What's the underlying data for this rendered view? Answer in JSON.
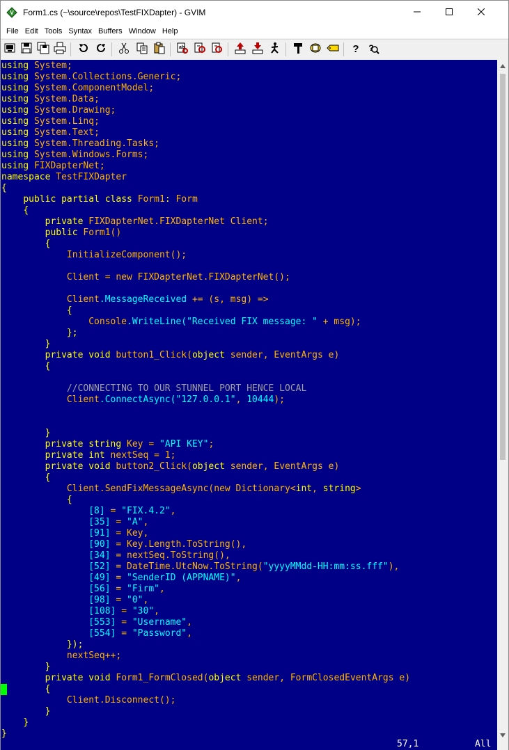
{
  "window": {
    "title": "Form1.cs (~\\source\\repos\\TestFIXDapter) - GVIM"
  },
  "menu": [
    "File",
    "Edit",
    "Tools",
    "Syntax",
    "Buffers",
    "Window",
    "Help"
  ],
  "toolbar": {
    "icons": [
      "open-icon",
      "save-icon",
      "save-all-icon",
      "print-icon",
      "undo-icon",
      "redo-icon",
      "cut-icon",
      "copy-icon",
      "paste-icon",
      "replace-icon",
      "find-next-icon",
      "find-prev-icon",
      "load-session-icon",
      "save-session-icon",
      "run-script-icon",
      "make-icon",
      "shell-icon",
      "tag-jump-icon",
      "help-icon",
      "find-help-icon"
    ]
  },
  "colors": {
    "background": "#000087",
    "keyword": "#ffff00",
    "type": "#ffb400",
    "identifier": "#00ffff",
    "comment": "#a0a0a0",
    "cursor": "#00ff00"
  },
  "code_lines": [
    [
      [
        "k",
        "using"
      ],
      [
        "n",
        " "
      ],
      [
        "t",
        "System"
      ],
      [
        "n",
        ";"
      ]
    ],
    [
      [
        "k",
        "using"
      ],
      [
        "n",
        " "
      ],
      [
        "t",
        "System.Collections.Generic"
      ],
      [
        "n",
        ";"
      ]
    ],
    [
      [
        "k",
        "using"
      ],
      [
        "n",
        " "
      ],
      [
        "t",
        "System.ComponentModel"
      ],
      [
        "n",
        ";"
      ]
    ],
    [
      [
        "k",
        "using"
      ],
      [
        "n",
        " "
      ],
      [
        "t",
        "System.Data"
      ],
      [
        "n",
        ";"
      ]
    ],
    [
      [
        "k",
        "using"
      ],
      [
        "n",
        " "
      ],
      [
        "t",
        "System.Drawing"
      ],
      [
        "n",
        ";"
      ]
    ],
    [
      [
        "k",
        "using"
      ],
      [
        "n",
        " "
      ],
      [
        "t",
        "System.Linq"
      ],
      [
        "n",
        ";"
      ]
    ],
    [
      [
        "k",
        "using"
      ],
      [
        "n",
        " "
      ],
      [
        "t",
        "System.Text"
      ],
      [
        "n",
        ";"
      ]
    ],
    [
      [
        "k",
        "using"
      ],
      [
        "n",
        " "
      ],
      [
        "t",
        "System.Threading.Tasks"
      ],
      [
        "n",
        ";"
      ]
    ],
    [
      [
        "k",
        "using"
      ],
      [
        "n",
        " "
      ],
      [
        "t",
        "System.Windows.Forms"
      ],
      [
        "n",
        ";"
      ]
    ],
    [
      [
        "k",
        "using"
      ],
      [
        "n",
        " "
      ],
      [
        "t",
        "FIXDapterNet"
      ],
      [
        "n",
        ";"
      ]
    ],
    [
      [
        "k",
        "namespace"
      ],
      [
        "t",
        " TestFIXDapter"
      ]
    ],
    [
      [
        "k",
        "{"
      ]
    ],
    [
      [
        "n",
        "    "
      ],
      [
        "k",
        "public partial class"
      ],
      [
        "n",
        " "
      ],
      [
        "t",
        "Form1"
      ],
      [
        "k",
        ":"
      ],
      [
        "t",
        " Form"
      ]
    ],
    [
      [
        "n",
        "    "
      ],
      [
        "k",
        "{"
      ]
    ],
    [
      [
        "n",
        "        "
      ],
      [
        "k",
        "private"
      ],
      [
        "t",
        " FIXDapterNet.FIXDapterNet Client;"
      ]
    ],
    [
      [
        "n",
        "        "
      ],
      [
        "k",
        "public"
      ],
      [
        "t",
        " Form1()"
      ]
    ],
    [
      [
        "n",
        "        "
      ],
      [
        "k",
        "{"
      ]
    ],
    [
      [
        "t",
        "            InitializeComponent();"
      ]
    ],
    [
      [
        "n",
        ""
      ]
    ],
    [
      [
        "t",
        "            Client = new FIXDapterNet.FIXDapterNet();"
      ]
    ],
    [
      [
        "n",
        ""
      ]
    ],
    [
      [
        "t",
        "            Client"
      ],
      [
        "i",
        ".MessageReceived"
      ],
      [
        "t",
        " += (s, msg) =>"
      ]
    ],
    [
      [
        "n",
        "            "
      ],
      [
        "k",
        "{"
      ]
    ],
    [
      [
        "t",
        "                Console"
      ],
      [
        "i",
        ".WriteLine("
      ],
      [
        "i",
        "\"Received FIX message: \""
      ],
      [
        "t",
        " + msg);"
      ]
    ],
    [
      [
        "n",
        "            "
      ],
      [
        "k",
        "};"
      ]
    ],
    [
      [
        "n",
        "        "
      ],
      [
        "k",
        "}"
      ]
    ],
    [
      [
        "n",
        "        "
      ],
      [
        "k",
        "private void"
      ],
      [
        "t",
        " button1_Click("
      ],
      [
        "k",
        "object"
      ],
      [
        "t",
        " sender, EventArgs e)"
      ]
    ],
    [
      [
        "n",
        "        "
      ],
      [
        "k",
        "{"
      ]
    ],
    [
      [
        "n",
        ""
      ]
    ],
    [
      [
        "c",
        "            //CONNECTING TO OUR STUNNEL PORT HENCE LOCAL"
      ]
    ],
    [
      [
        "t",
        "            Client"
      ],
      [
        "i",
        ".ConnectAsync("
      ],
      [
        "i",
        "\"127.0.0.1\""
      ],
      [
        "t",
        ", "
      ],
      [
        "i",
        "10444"
      ],
      [
        "t",
        ");"
      ]
    ],
    [
      [
        "n",
        ""
      ]
    ],
    [
      [
        "n",
        ""
      ]
    ],
    [
      [
        "n",
        "        "
      ],
      [
        "k",
        "}"
      ]
    ],
    [
      [
        "n",
        "        "
      ],
      [
        "k",
        "private string"
      ],
      [
        "t",
        " Key = "
      ],
      [
        "i",
        "\"API KEY\""
      ],
      [
        "t",
        ";"
      ]
    ],
    [
      [
        "n",
        "        "
      ],
      [
        "k",
        "private int"
      ],
      [
        "t",
        " nextSeq = 1;"
      ]
    ],
    [
      [
        "n",
        "        "
      ],
      [
        "k",
        "private void"
      ],
      [
        "t",
        " button2_Click("
      ],
      [
        "k",
        "object"
      ],
      [
        "t",
        " sender, EventArgs e)"
      ]
    ],
    [
      [
        "n",
        "        "
      ],
      [
        "k",
        "{"
      ]
    ],
    [
      [
        "t",
        "            Client.SendFixMessageAsync(new Dictionary<"
      ],
      [
        "k",
        "int"
      ],
      [
        "t",
        ", "
      ],
      [
        "k",
        "string"
      ],
      [
        "t",
        ">"
      ]
    ],
    [
      [
        "n",
        "            "
      ],
      [
        "k",
        "{"
      ]
    ],
    [
      [
        "i",
        "                [8]"
      ],
      [
        "t",
        " = "
      ],
      [
        "i",
        "\"FIX.4.2\""
      ],
      [
        "t",
        ","
      ]
    ],
    [
      [
        "i",
        "                [35]"
      ],
      [
        "t",
        " = "
      ],
      [
        "i",
        "\"A\""
      ],
      [
        "t",
        ","
      ]
    ],
    [
      [
        "i",
        "                [91]"
      ],
      [
        "t",
        " = Key,"
      ]
    ],
    [
      [
        "i",
        "                [90]"
      ],
      [
        "t",
        " = Key.Length.ToString(),"
      ]
    ],
    [
      [
        "i",
        "                [34]"
      ],
      [
        "t",
        " = nextSeq.ToString(),"
      ]
    ],
    [
      [
        "i",
        "                [52]"
      ],
      [
        "t",
        " = DateTime.UtcNow.ToString("
      ],
      [
        "i",
        "\"yyyyMMdd-HH:mm:ss.fff\""
      ],
      [
        "t",
        "),"
      ]
    ],
    [
      [
        "i",
        "                [49]"
      ],
      [
        "t",
        " = "
      ],
      [
        "i",
        "\"SenderID (APPNAME)\""
      ],
      [
        "t",
        ","
      ]
    ],
    [
      [
        "i",
        "                [56]"
      ],
      [
        "t",
        " = "
      ],
      [
        "i",
        "\"Firm\""
      ],
      [
        "t",
        ","
      ]
    ],
    [
      [
        "i",
        "                [98]"
      ],
      [
        "t",
        " = "
      ],
      [
        "i",
        "\"0\""
      ],
      [
        "t",
        ","
      ]
    ],
    [
      [
        "i",
        "                [108]"
      ],
      [
        "t",
        " = "
      ],
      [
        "i",
        "\"30\""
      ],
      [
        "t",
        ","
      ]
    ],
    [
      [
        "i",
        "                [553]"
      ],
      [
        "t",
        " = "
      ],
      [
        "i",
        "\"Username\""
      ],
      [
        "t",
        ","
      ]
    ],
    [
      [
        "i",
        "                [554]"
      ],
      [
        "t",
        " = "
      ],
      [
        "i",
        "\"Password\""
      ],
      [
        "t",
        ","
      ]
    ],
    [
      [
        "n",
        "            "
      ],
      [
        "k",
        "});"
      ]
    ],
    [
      [
        "t",
        "            nextSeq++;"
      ]
    ],
    [
      [
        "n",
        "        "
      ],
      [
        "k",
        "}"
      ]
    ],
    [
      [
        "n",
        "        "
      ],
      [
        "k",
        "private void"
      ],
      [
        "t",
        " Form1_FormClosed("
      ],
      [
        "k",
        "object"
      ],
      [
        "t",
        " sender, FormClosedEventArgs e)"
      ]
    ],
    [
      [
        "n",
        "        "
      ],
      [
        "k",
        "{"
      ]
    ],
    [
      [
        "t",
        "            Client.Disconnect();"
      ]
    ],
    [
      [
        "n",
        "        "
      ],
      [
        "k",
        "}"
      ]
    ],
    [
      [
        "n",
        "    "
      ],
      [
        "k",
        "}"
      ]
    ],
    [
      [
        "k",
        "}"
      ]
    ]
  ],
  "cursor_line_index": 56,
  "status": {
    "position": "57,1",
    "scroll": "All"
  }
}
